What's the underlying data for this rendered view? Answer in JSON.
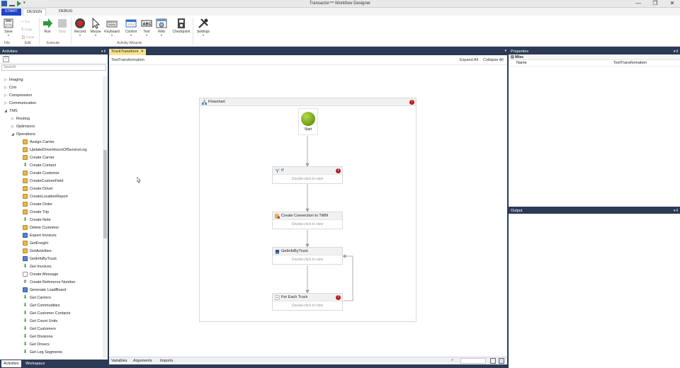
{
  "window": {
    "title": "Transactor™ Workflow Designer",
    "controls": [
      "—",
      "❐",
      "✕"
    ]
  },
  "ribbon_tabs": {
    "start": "START",
    "design": "DESIGN",
    "debug": "DEBUG"
  },
  "ribbon": {
    "save": "Save",
    "cut": "Cut",
    "copy": "Copy",
    "paste": "Paste",
    "run": "Run",
    "stop": "Stop",
    "record": "Record",
    "mouse": "Mouse",
    "keyboard": "Keyboard",
    "control": "Control",
    "text": "Text",
    "web": "Web",
    "checkpoint": "Checkpoint",
    "settings": "Settings",
    "groups": {
      "file": "File",
      "edit": "Edit",
      "execute": "Execute",
      "wizards": "Activity Wizards"
    }
  },
  "activities": {
    "header": "Activities",
    "search_placeholder": "Search",
    "items": [
      {
        "label": "Imaging",
        "level": 0,
        "exp": "▷",
        "icon": ""
      },
      {
        "label": "Crm",
        "level": 0,
        "exp": "▷",
        "icon": ""
      },
      {
        "label": "Compression",
        "level": 0,
        "exp": "▷",
        "icon": ""
      },
      {
        "label": "Communication",
        "level": 0,
        "exp": "▷",
        "icon": ""
      },
      {
        "label": "TMS",
        "level": 0,
        "exp": "◢",
        "icon": ""
      },
      {
        "label": "Routing",
        "level": 1,
        "exp": "▷",
        "icon": ""
      },
      {
        "label": "Optimizers",
        "level": 1,
        "exp": "▷",
        "icon": ""
      },
      {
        "label": "Operations",
        "level": 1,
        "exp": "◢",
        "icon": ""
      },
      {
        "label": "Assign Carrier",
        "level": 2,
        "exp": "",
        "icon": "fold"
      },
      {
        "label": "UpdateDriverHoursOfServiceLog",
        "level": 2,
        "exp": "",
        "icon": "fold"
      },
      {
        "label": "Create Carrier",
        "level": 2,
        "exp": "",
        "icon": "fold"
      },
      {
        "label": "Create Contact",
        "level": 2,
        "exp": "",
        "icon": "down"
      },
      {
        "label": "Create Customer",
        "level": 2,
        "exp": "",
        "icon": "fold"
      },
      {
        "label": "CreateCustomField",
        "level": 2,
        "exp": "",
        "icon": "fold"
      },
      {
        "label": "Create Driver",
        "level": 2,
        "exp": "",
        "icon": "fold"
      },
      {
        "label": "CreateLocationReport",
        "level": 2,
        "exp": "",
        "icon": "fold"
      },
      {
        "label": "Create Order",
        "level": 2,
        "exp": "",
        "icon": "fold"
      },
      {
        "label": "Create Trip",
        "level": 2,
        "exp": "",
        "icon": "fold"
      },
      {
        "label": "Create Note",
        "level": 2,
        "exp": "",
        "icon": "down"
      },
      {
        "label": "Delete Customer",
        "level": 2,
        "exp": "",
        "icon": "fold"
      },
      {
        "label": "Export Invoices",
        "level": 2,
        "exp": "",
        "icon": "blue"
      },
      {
        "label": "GetFreight",
        "level": 2,
        "exp": "",
        "icon": "fold"
      },
      {
        "label": "GetActivities",
        "level": 2,
        "exp": "",
        "icon": "fold"
      },
      {
        "label": "GetInfoByTruck",
        "level": 2,
        "exp": "",
        "icon": "blue"
      },
      {
        "label": "Get Invoices",
        "level": 2,
        "exp": "",
        "icon": "down"
      },
      {
        "label": "Create Message",
        "level": 2,
        "exp": "",
        "icon": "doc"
      },
      {
        "label": "Create Reference Number",
        "level": 2,
        "exp": "",
        "icon": "hash"
      },
      {
        "label": "Generate LoadBoard",
        "level": 2,
        "exp": "",
        "icon": "blue"
      },
      {
        "label": "Get Carriers",
        "level": 2,
        "exp": "",
        "icon": "down"
      },
      {
        "label": "Get Commodities",
        "level": 2,
        "exp": "",
        "icon": "down"
      },
      {
        "label": "Get Customer Contacts",
        "level": 2,
        "exp": "",
        "icon": "down"
      },
      {
        "label": "Get Count Units",
        "level": 2,
        "exp": "",
        "icon": "down"
      },
      {
        "label": "Get Customers",
        "level": 2,
        "exp": "",
        "icon": "down"
      },
      {
        "label": "Get Divisions",
        "level": 2,
        "exp": "",
        "icon": "down"
      },
      {
        "label": "Get Drivers",
        "level": 2,
        "exp": "",
        "icon": "down"
      },
      {
        "label": "Get Leg Segments",
        "level": 2,
        "exp": "",
        "icon": "down"
      }
    ],
    "bottom_tabs": {
      "activities": "Activities",
      "workspace": "Workspace"
    }
  },
  "designer": {
    "tab": "TruckTransform",
    "tab_close": "✕",
    "breadcrumb": "TestTransformation",
    "expand_all": "Expand All",
    "collapse_all": "Collapse All",
    "flowchart_title": "Flowchart",
    "start_label": "Start",
    "nodes": {
      "if": {
        "title": "If",
        "hint": "Double-click to view"
      },
      "create_conn": {
        "title": "Create Connection to TMM",
        "hint": "Double-click to view"
      },
      "getinfo": {
        "title": "GetInfoByTruck",
        "hint": "Double-click to view"
      },
      "foreach": {
        "title": "For Each Truck",
        "hint": "Double-click to view"
      }
    },
    "bottom_tabs": {
      "variables": "Variables",
      "arguments": "Arguments",
      "imports": "Imports"
    }
  },
  "properties": {
    "header": "Properties",
    "group": "Misc",
    "name_label": "Name",
    "name_value": "TestTransformation"
  },
  "output": {
    "header": "Output"
  },
  "colors": {
    "frame": "#2b3a55",
    "tab_active": "#fce28f",
    "start": "#1d46c9",
    "error": "#c0171b"
  }
}
